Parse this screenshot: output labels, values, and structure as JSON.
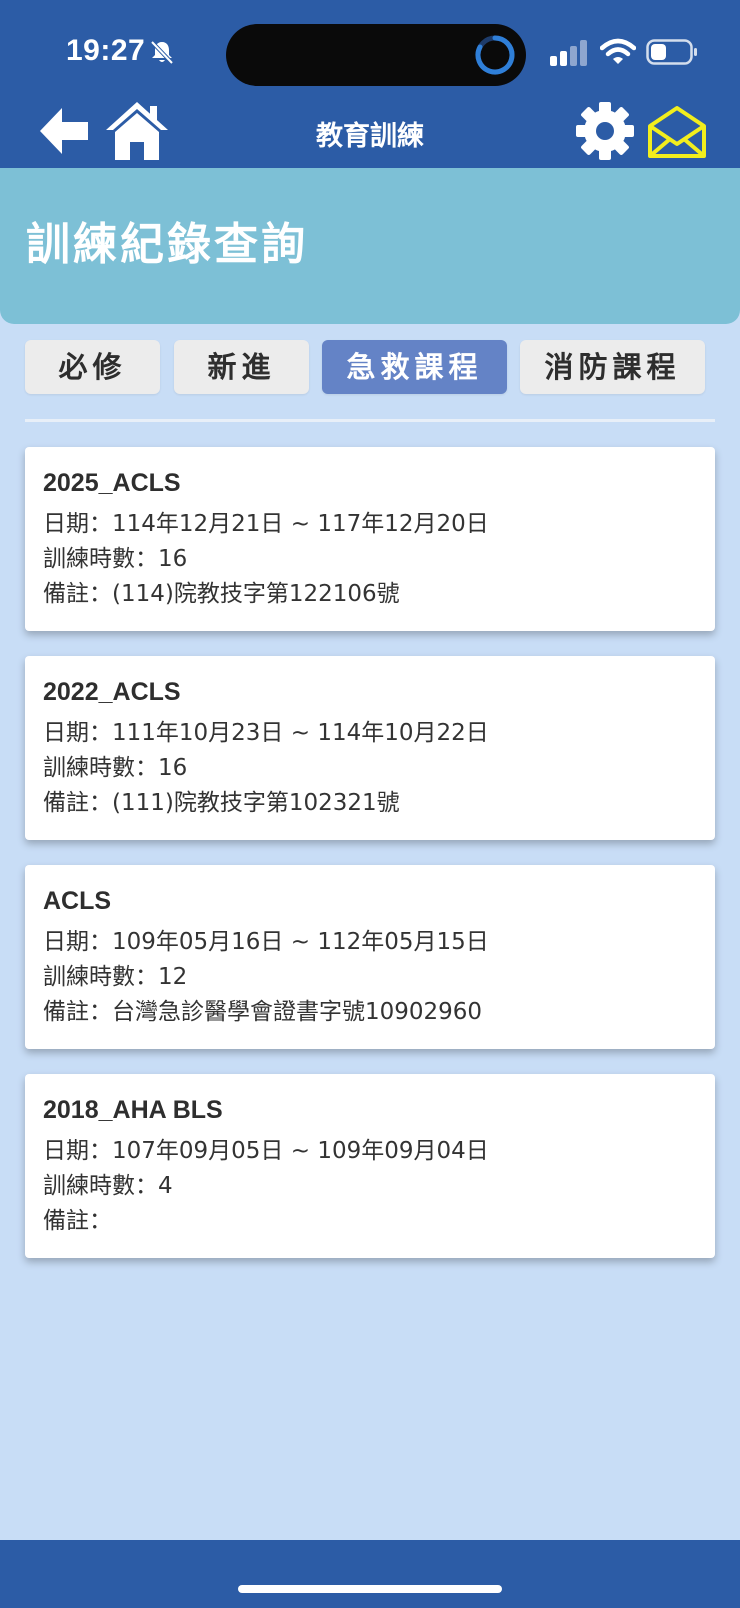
{
  "status_bar": {
    "time": "19:27"
  },
  "nav": {
    "title": "教育訓練"
  },
  "header": {
    "title": "訓練紀錄查詢"
  },
  "tabs": [
    {
      "label": "必修",
      "active": false
    },
    {
      "label": "新進",
      "active": false
    },
    {
      "label": "急救課程",
      "active": true
    },
    {
      "label": "消防課程",
      "active": false
    }
  ],
  "records": [
    {
      "title": "2025_ACLS",
      "date": "日期：114年12月21日 ~ 117年12月20日",
      "hours": "訓練時數：16",
      "note": "備註：(114)院教技字第122106號"
    },
    {
      "title": "2022_ACLS",
      "date": "日期：111年10月23日 ~ 114年10月22日",
      "hours": "訓練時數：16",
      "note": "備註：(111)院教技字第102321號"
    },
    {
      "title": "ACLS",
      "date": "日期：109年05月16日 ~ 112年05月15日",
      "hours": "訓練時數：12",
      "note": "備註：台灣急診醫學會證書字號10902960"
    },
    {
      "title": "2018_AHA BLS",
      "date": "日期：107年09月05日 ~ 109年09月04日",
      "hours": "訓練時數：4",
      "note": "備註："
    }
  ],
  "icons": {
    "back": "back-arrow-icon",
    "home": "home-icon",
    "settings": "gear-icon",
    "mail": "mail-icon"
  },
  "colors": {
    "brand_blue": "#2c5ca6",
    "header_teal": "#7dc0d6",
    "active_tab": "#6483c6",
    "mail_icon": "#f2ee1d",
    "background": "#c8ddf6"
  }
}
